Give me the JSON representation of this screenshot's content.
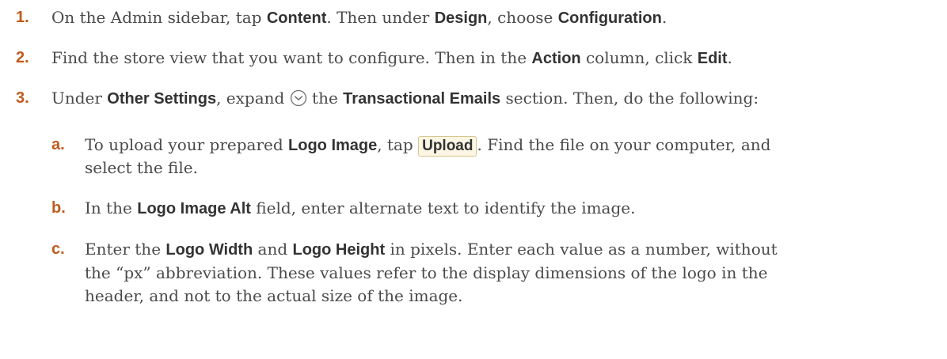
{
  "steps": [
    {
      "number": "1.",
      "t1": "On the Admin sidebar, tap ",
      "b1": "Content",
      "t2": ". Then under ",
      "b2": "Design",
      "t3": ", choose ",
      "b3": "Configuration",
      "t4": "."
    },
    {
      "number": "2.",
      "t1": "Find the store view that you want to configure. Then in the ",
      "b1": "Action",
      "t2": " column, click ",
      "b2": "Edit",
      "t3": "."
    },
    {
      "number": "3.",
      "t1": "Under ",
      "b1": "Other Settings",
      "t2": ", expand ",
      "icon": "expand-circle-chevron-icon",
      "t3": " the ",
      "b2": "Transactional Emails",
      "t4": " section. Then, do the following:"
    }
  ],
  "substeps": [
    {
      "letter": "a.",
      "t1": "To upload your prepared ",
      "b1": "Logo Image",
      "t2": ", tap ",
      "button": "Upload",
      "t3": ". Find the file on your computer, and",
      "line2": "select the file."
    },
    {
      "letter": "b.",
      "t1": "In the ",
      "b1": "Logo Image Alt",
      "t2": " field, enter alternate text to identify the image."
    },
    {
      "letter": "c.",
      "t1": "Enter the ",
      "b1": "Logo Width",
      "t2": " and ",
      "b2": "Logo Height",
      "t3": " in pixels. Enter each value as a number, without",
      "line2": "the “px” abbreviation. These values refer to the display dimensions of the logo in the",
      "line3": "header, and not to the actual size of the image."
    }
  ],
  "colors": {
    "number": "#c05a1c",
    "body_text": "#4a4a4a",
    "bold_text": "#333333",
    "button_bg": "#fbf6e4",
    "button_border": "#d8c48c"
  }
}
